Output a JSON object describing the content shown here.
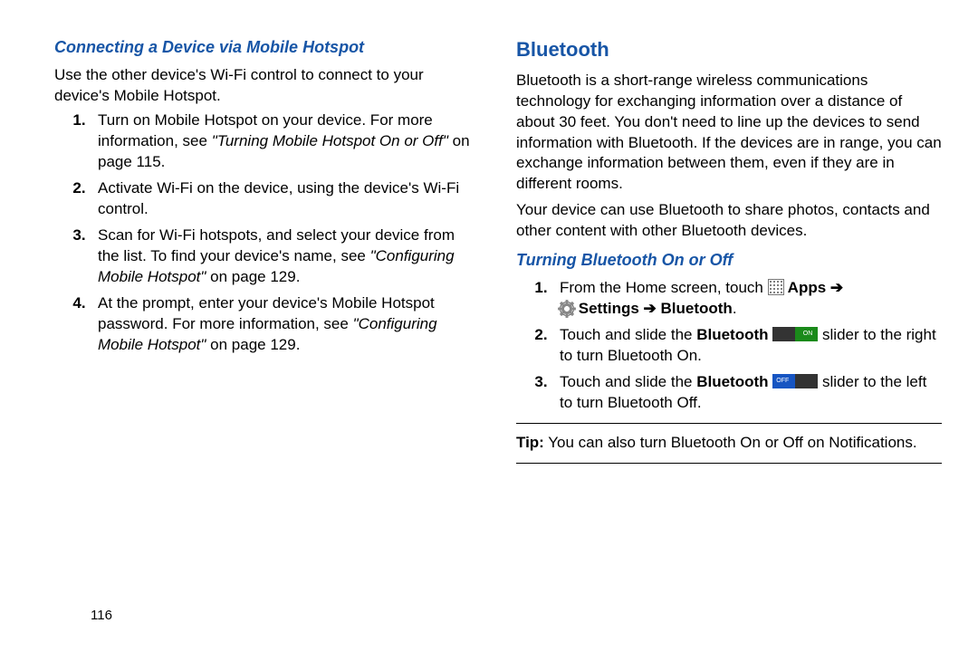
{
  "left": {
    "heading": "Connecting a Device via Mobile Hotspot",
    "intro": "Use the other device's Wi-Fi control to connect to your device's Mobile Hotspot.",
    "step1_a": "Turn on Mobile Hotspot on your device. For more information, see ",
    "step1_ital": "\"Turning Mobile Hotspot On or Off\"",
    "step1_b": " on page 115.",
    "step2": "Activate Wi-Fi on the device, using the device's Wi-Fi control.",
    "step3_a": "Scan for Wi-Fi hotspots, and select your device from the list. To find your device's name, see ",
    "step3_ital": "\"Configuring Mobile Hotspot\"",
    "step3_b": " on page 129.",
    "step4_a": "At the prompt, enter your device's Mobile Hotspot password. For more information, see ",
    "step4_ital": "\"Configuring Mobile Hotspot\"",
    "step4_b": " on page 129."
  },
  "right": {
    "heading": "Bluetooth",
    "para1": "Bluetooth is a short-range wireless communications technology for exchanging information over a distance of about 30 feet. You don't need to line up the devices to send information with Bluetooth. If the devices are in range, you can exchange information between them, even if they are in different rooms.",
    "para2": "Your device can use Bluetooth to share photos, contacts and other content with other Bluetooth devices.",
    "sub": "Turning Bluetooth On or Off",
    "step1_a": "From the Home screen, touch ",
    "step1_apps": " Apps ",
    "step1_arrow1": "➔",
    "step1_settings": "Settings ",
    "step1_arrow2": "➔",
    "step1_bt": " Bluetooth",
    "step1_end": ".",
    "step2_a": "Touch and slide the ",
    "step2_bt": "Bluetooth",
    "step2_b": " slider to the right to turn Bluetooth On.",
    "step3_a": "Touch and slide the ",
    "step3_bt": "Bluetooth",
    "step3_b": " slider to the left to turn Bluetooth Off.",
    "tip_label": "Tip:",
    "tip_text": " You can also turn Bluetooth On or Off on Notifications."
  },
  "pagenum": "116"
}
